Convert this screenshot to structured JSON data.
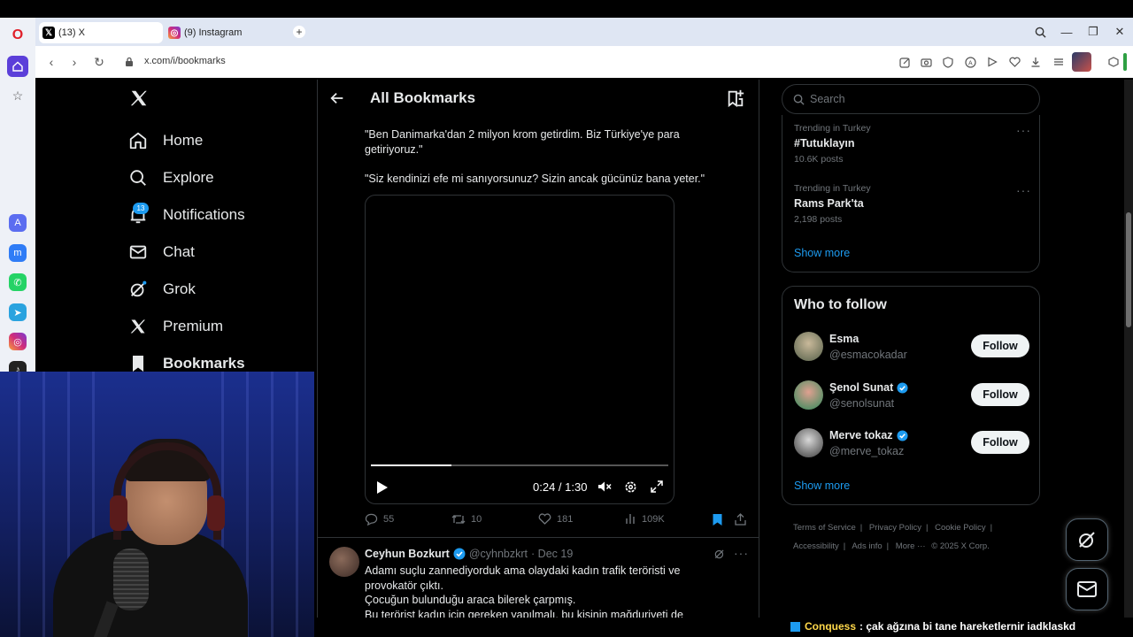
{
  "browser": {
    "tabs": [
      {
        "title": "(13) X",
        "active": true
      },
      {
        "title": "(9) Instagram",
        "active": false
      }
    ],
    "url": "x.com/i/bookmarks"
  },
  "nav": {
    "home": "Home",
    "explore": "Explore",
    "notifications": "Notifications",
    "notifications_badge": "13",
    "chat": "Chat",
    "grok": "Grok",
    "premium": "Premium",
    "bookmarks": "Bookmarks"
  },
  "header": {
    "title": "All Bookmarks"
  },
  "tweet1": {
    "line1": "\"Ben Danimarka'dan 2 milyon krom getirdim. Biz Türkiye'ye para getiriyoruz.\"",
    "line2": "\"Siz kendinizi efe mi sanıyorsunuz? Sizin ancak gücünüz bana yeter.\"",
    "video_time": "0:24 / 1:30",
    "video_progress": 0.27,
    "replies": "55",
    "reposts": "10",
    "likes": "181",
    "views": "109K"
  },
  "tweet2": {
    "name": "Ceyhun Bozkurt",
    "handle": "@cyhnbzkrt",
    "date": "· Dec 19",
    "line1": "Adamı suçlu zannediyorduk ama olaydaki kadın trafik teröristi ve provokatör çıktı.",
    "line2": "Çocuğun bulunduğu araca bilerek çarpmış.",
    "line3": "Bu terörist kadın için gereken yapılmalı, bu kişinin mağduriyeti de"
  },
  "search": {
    "placeholder": "Search"
  },
  "trends": {
    "items": [
      {
        "context": "Trending in Turkey",
        "name": "#Tutuklayın",
        "count": "10.6K posts"
      },
      {
        "context": "Trending in Turkey",
        "name": "Rams Park'ta",
        "count": "2,198 posts"
      }
    ],
    "show_more": "Show more"
  },
  "who_to_follow": {
    "title": "Who to follow",
    "users": [
      {
        "name": "Esma",
        "handle": "@esmacokadar",
        "verified": false,
        "button": "Follow"
      },
      {
        "name": "Şenol Sunat",
        "handle": "@senolsunat",
        "verified": true,
        "button": "Follow"
      },
      {
        "name": "Merve tokaz",
        "handle": "@merve_tokaz",
        "verified": true,
        "button": "Follow"
      }
    ],
    "show_more": "Show more"
  },
  "footer": {
    "terms": "Terms of Service",
    "privacy": "Privacy Policy",
    "cookie": "Cookie Policy",
    "accessibility": "Accessibility",
    "ads": "Ads info",
    "more": "More ···",
    "copyright": "© 2025 X Corp."
  },
  "stream_chat": {
    "user": "Conquess",
    "message": ": çak ağzına bi tane hareketlernir iadklaskd"
  },
  "colors": {
    "accent": "#1d9bf0",
    "background": "#000000",
    "text": "#e7e9ea",
    "muted": "#71767b",
    "border": "#2f3336"
  }
}
